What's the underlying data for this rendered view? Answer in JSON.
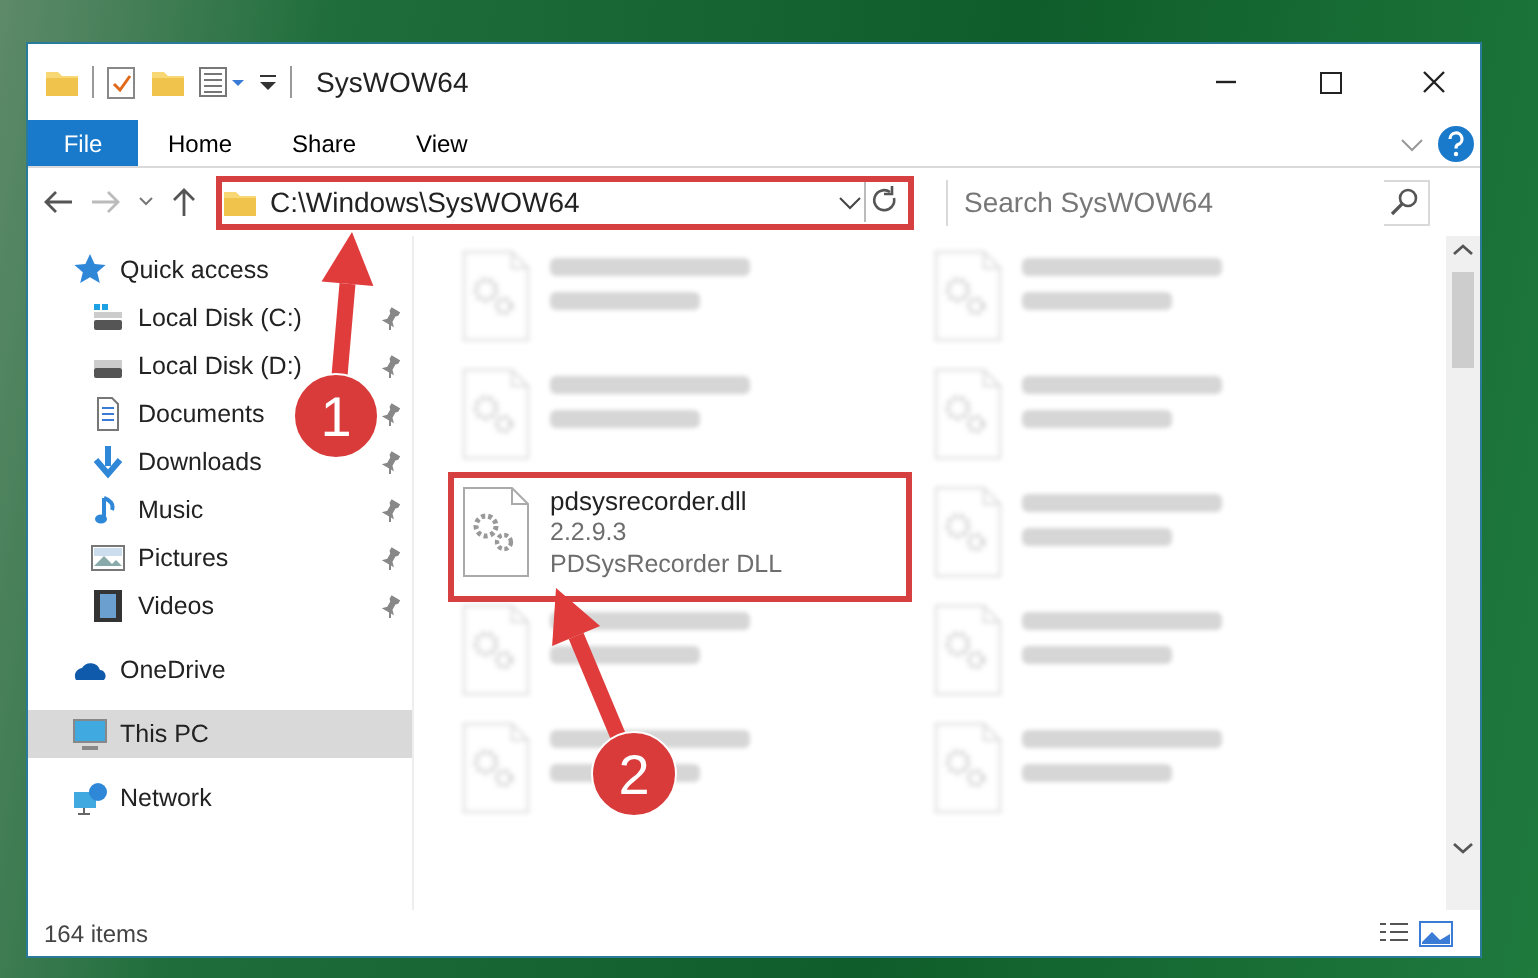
{
  "window": {
    "title": "SysWOW64"
  },
  "ribbon": {
    "tabs": [
      {
        "label": "File",
        "kind": "file",
        "selected": false
      },
      {
        "label": "Home",
        "kind": "tab",
        "selected": false
      },
      {
        "label": "Share",
        "kind": "tab",
        "selected": false
      },
      {
        "label": "View",
        "kind": "tab",
        "selected": false
      }
    ]
  },
  "address_bar": {
    "path": "C:\\Windows\\SysWOW64",
    "highlighted": true
  },
  "search": {
    "placeholder": "Search SysWOW64"
  },
  "sidebar": {
    "items": [
      {
        "label": "Quick access",
        "kind": "quick",
        "selected": false,
        "children": [
          {
            "label": "Local Disk (C:)",
            "kind": "disk-c",
            "pinned": true,
            "selected": false
          },
          {
            "label": "Local Disk (D:)",
            "kind": "disk",
            "pinned": true,
            "selected": false
          },
          {
            "label": "Documents",
            "kind": "documents",
            "pinned": true,
            "selected": false
          },
          {
            "label": "Downloads",
            "kind": "downloads",
            "pinned": true,
            "selected": false
          },
          {
            "label": "Music",
            "kind": "music",
            "pinned": true,
            "selected": false
          },
          {
            "label": "Pictures",
            "kind": "pictures",
            "pinned": true,
            "selected": false
          },
          {
            "label": "Videos",
            "kind": "videos",
            "pinned": true,
            "selected": false
          }
        ]
      },
      {
        "label": "OneDrive",
        "kind": "onedrive",
        "selected": false
      },
      {
        "label": "This PC",
        "kind": "pc",
        "selected": true
      },
      {
        "label": "Network",
        "kind": "network",
        "selected": false
      }
    ]
  },
  "files": [
    {
      "kind": "blurred",
      "highlighted": false
    },
    {
      "kind": "blurred",
      "highlighted": false
    },
    {
      "kind": "blurred",
      "highlighted": false
    },
    {
      "kind": "blurred",
      "highlighted": false
    },
    {
      "kind": "file",
      "name": "pdsysrecorder.dll",
      "details": [
        "2.2.9.3",
        "PDSysRecorder DLL"
      ],
      "highlighted": true
    },
    {
      "kind": "blurred",
      "highlighted": false
    },
    {
      "kind": "blurred",
      "highlighted": false
    },
    {
      "kind": "blurred",
      "highlighted": false
    },
    {
      "kind": "blurred",
      "highlighted": false
    },
    {
      "kind": "blurred",
      "highlighted": false
    }
  ],
  "status_bar": {
    "item_count": "164 items"
  },
  "annotations": [
    {
      "label": "1"
    },
    {
      "label": "2"
    }
  ]
}
